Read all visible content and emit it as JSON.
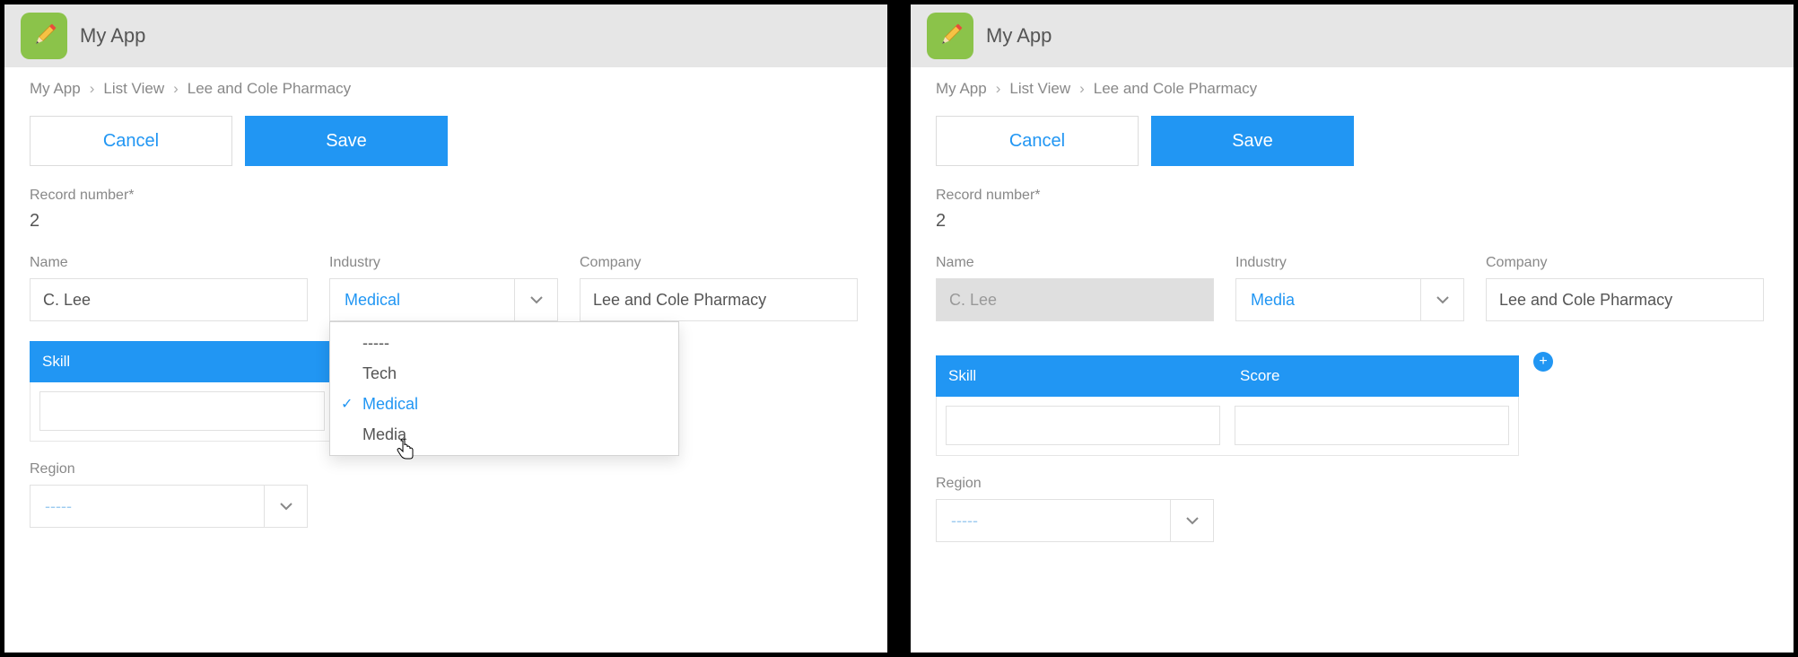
{
  "app": {
    "title": "My App"
  },
  "breadcrumb": {
    "root": "My App",
    "view": "List View",
    "record": "Lee and Cole Pharmacy"
  },
  "buttons": {
    "cancel": "Cancel",
    "save": "Save"
  },
  "labels": {
    "record_number": "Record number*",
    "name": "Name",
    "industry": "Industry",
    "company": "Company",
    "skill": "Skill",
    "score": "Score",
    "region": "Region"
  },
  "left": {
    "record_number": "2",
    "name_value": "C. Lee",
    "industry_value": "Medical",
    "industry_options": {
      "blank": "-----",
      "tech": "Tech",
      "medical": "Medical",
      "media": "Media"
    },
    "company_value": "Lee and Cole Pharmacy",
    "region_value": "-----"
  },
  "right": {
    "record_number": "2",
    "name_value": "C. Lee",
    "industry_value": "Media",
    "company_value": "Lee and Cole Pharmacy",
    "region_value": "-----"
  }
}
